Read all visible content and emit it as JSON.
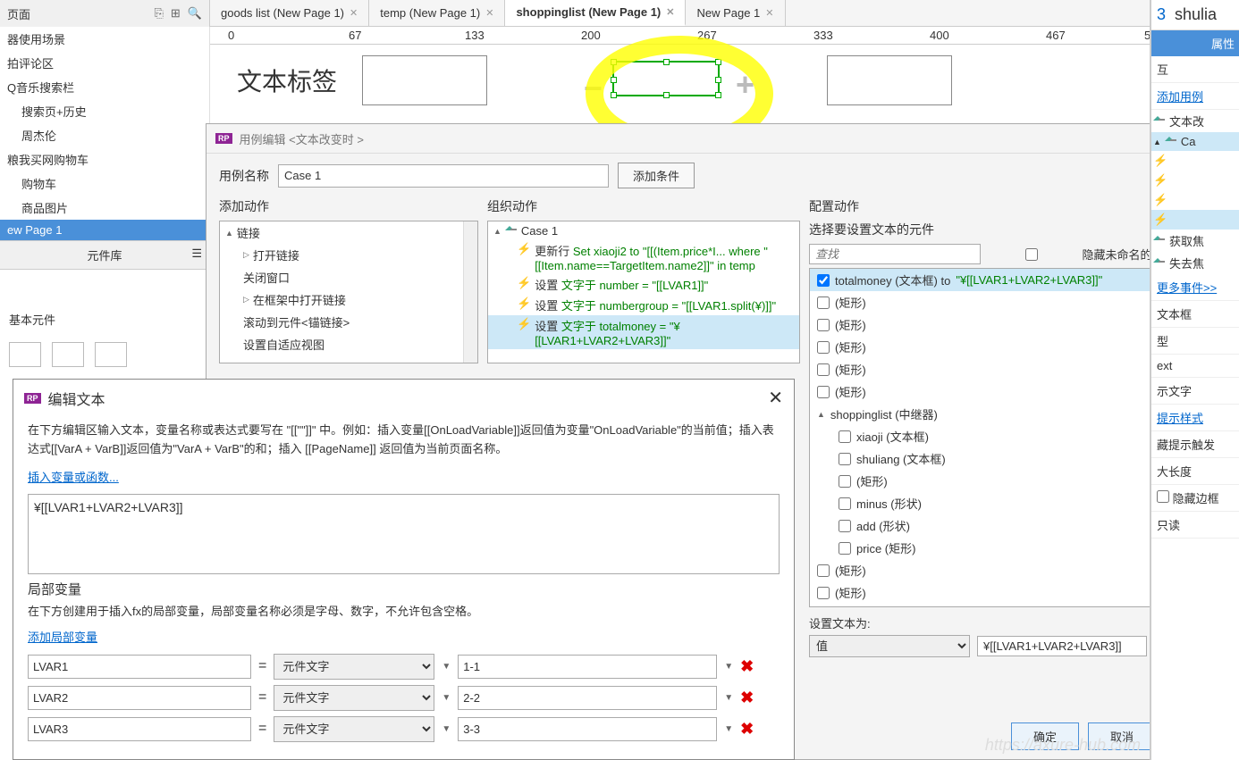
{
  "pagesHeader": {
    "title": "页面"
  },
  "tabs": [
    {
      "label": "goods list (New Page 1)",
      "active": false
    },
    {
      "label": "temp (New Page 1)",
      "active": false
    },
    {
      "label": "shoppinglist (New Page 1)",
      "active": true
    },
    {
      "label": "New Page 1",
      "active": false
    }
  ],
  "tree": [
    {
      "label": "器使用场景",
      "lvl": 1
    },
    {
      "label": "拍评论区",
      "lvl": 1
    },
    {
      "label": "Q音乐搜索栏",
      "lvl": 1
    },
    {
      "label": "搜索页+历史",
      "lvl": 2
    },
    {
      "label": "周杰伦",
      "lvl": 2
    },
    {
      "label": "粮我买网购物车",
      "lvl": 1
    },
    {
      "label": "购物车",
      "lvl": 2
    },
    {
      "label": "商品图片",
      "lvl": 2
    },
    {
      "label": "ew Page 1",
      "lvl": 1,
      "active": true
    }
  ],
  "libHeader": "元件库",
  "basic": "基本元件",
  "ruler": {
    "v0": "0",
    "v67": "67",
    "v133": "133",
    "v200": "200",
    "v267": "267",
    "v333": "333",
    "v400": "400",
    "v467": "467",
    "v5": "5"
  },
  "canvasLabel": "文本标签",
  "caseEditor": {
    "title": "用例编辑 <文本改变时 >",
    "nameLabel": "用例名称",
    "nameValue": "Case 1",
    "addCondition": "添加条件",
    "addActions": "添加动作",
    "orgActions": "组织动作",
    "configActions": "配置动作",
    "linkGroup": "链接",
    "actions": [
      "打开链接",
      "关闭窗口",
      "在框架中打开链接",
      "滚动到元件<锚链接>",
      "设置自适应视图"
    ],
    "case1": "Case 1",
    "caseItems": [
      {
        "a": "更新行",
        "b": "Set xiaoji2 to \"[[(Item.price*I... where \"[[Item.name==TargetItem.name2]]\" in temp"
      },
      {
        "a": "设置",
        "b": "文字于 number = \"[[LVAR1]]\""
      },
      {
        "a": "设置",
        "b": "文字于 numbergroup = \"[[LVAR1.split(¥)]]\""
      },
      {
        "a": "设置",
        "b": "文字于 totalmoney = \"¥[[LVAR1+LVAR2+LVAR3]]\"",
        "sel": true
      }
    ],
    "selectLabel": "选择要设置文本的元件",
    "searchPlaceholder": "查找",
    "hideUnnamed": "隐藏未命名的元件",
    "elements": [
      {
        "label": "totalmoney (文本框) to",
        "val": "\"¥[[LVAR1+LVAR2+LVAR3]]\"",
        "sel": true,
        "checked": true,
        "lvl": 1
      },
      {
        "label": "(矩形)",
        "lvl": 1
      },
      {
        "label": "(矩形)",
        "lvl": 1
      },
      {
        "label": "(矩形)",
        "lvl": 1
      },
      {
        "label": "(矩形)",
        "lvl": 1
      },
      {
        "label": "(矩形)",
        "lvl": 1
      },
      {
        "label": "shoppinglist (中继器)",
        "lvl": 1,
        "collapsed": false
      },
      {
        "label": "xiaoji (文本框)",
        "lvl": 2
      },
      {
        "label": "shuliang (文本框)",
        "lvl": 2
      },
      {
        "label": "(矩形)",
        "lvl": 2
      },
      {
        "label": "minus (形状)",
        "lvl": 2
      },
      {
        "label": "add (形状)",
        "lvl": 2
      },
      {
        "label": "price (矩形)",
        "lvl": 2
      },
      {
        "label": "(矩形)",
        "lvl": 1
      },
      {
        "label": "(矩形)",
        "lvl": 1
      }
    ],
    "setTextLabel": "设置文本为:",
    "setTextType": "值",
    "setTextValue": "¥[[LVAR1+LVAR2+LVAR3]]",
    "ok": "确定",
    "cancel": "取消"
  },
  "editText": {
    "title": "编辑文本",
    "desc": "在下方编辑区输入文本，变量名称或表达式要写在 \"[[\"\"]]\" 中。例如：插入变量[[OnLoadVariable]]返回值为变量\"OnLoadVariable\"的当前值；插入表达式[[VarA + VarB]]返回值为\"VarA + VarB\"的和；插入 [[PageName]] 返回值为当前页面名称。",
    "insertLink": "插入变量或函数...",
    "value": "¥[[LVAR1+LVAR2+LVAR3]]",
    "localVarTitle": "局部变量",
    "localVarDesc": "在下方创建用于插入fx的局部变量，局部变量名称必须是字母、数字，不允许包含空格。",
    "addLocalVar": "添加局部变量",
    "vars": [
      {
        "name": "LVAR1",
        "type": "元件文字",
        "target": "1-1"
      },
      {
        "name": "LVAR2",
        "type": "元件文字",
        "target": "2-2"
      },
      {
        "name": "LVAR3",
        "type": "元件文字",
        "target": "3-3"
      }
    ]
  },
  "rightPanel": {
    "num": "3",
    "name": "shulia",
    "tab": "属性",
    "interact": "互",
    "addCase": "添加用例",
    "textChange": "文本改",
    "case": "Ca",
    "getFocus": "获取焦",
    "loseFocus": "失去焦",
    "moreEvents": "更多事件>>",
    "textBox": "文本框",
    "type": "型",
    "ext": "ext",
    "tipText": "示文字",
    "tipStyle": "提示样式",
    "hideTrigger": "藏提示触发",
    "maxLen": "大长度",
    "hideBorder": "隐藏边框",
    "readonly": "只读"
  },
  "watermark": "https://axure-hub.com"
}
